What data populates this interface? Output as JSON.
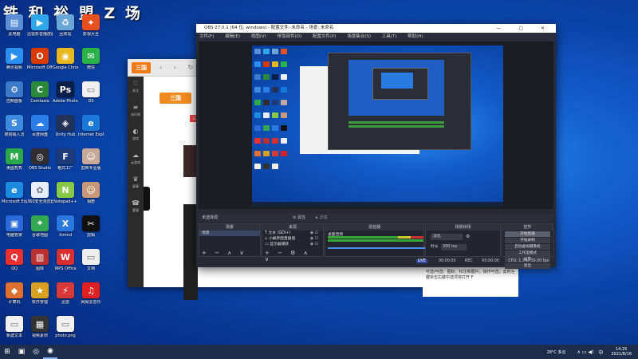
{
  "watermark": "铁 和 裕 盟 Z 场",
  "desktop_icons": [
    {
      "name": "此电脑",
      "color": "#5a8fd8",
      "glyph": "▤",
      "icon": "computer-icon"
    },
    {
      "name": "迅雷影音播放器",
      "color": "#2fa6ea",
      "glyph": "▶",
      "icon": "player-icon"
    },
    {
      "name": "回收站",
      "color": "#6aa6d8",
      "glyph": "♻",
      "icon": "recycle-bin-icon"
    },
    {
      "name": "影视大全",
      "color": "#e85020",
      "glyph": "✦",
      "icon": "video-icon"
    },
    {
      "name": "腾讯视频",
      "color": "#2a90f0",
      "glyph": "▶",
      "icon": "tencent-video-icon"
    },
    {
      "name": "Microsoft Office",
      "color": "#d83b01",
      "glyph": "O",
      "icon": "office-icon"
    },
    {
      "name": "Google Chrome",
      "color": "#e8b820",
      "glyph": "◉",
      "icon": "chrome-icon"
    },
    {
      "name": "微信",
      "color": "#2bb34a",
      "glyph": "✉",
      "icon": "wechat-icon"
    },
    {
      "name": "控制面板",
      "color": "#3a78c8",
      "glyph": "⚙",
      "icon": "control-panel-icon"
    },
    {
      "name": "Camtasia",
      "color": "#2a8a3a",
      "glyph": "C",
      "icon": "camtasia-icon"
    },
    {
      "name": "Adobe Photoshop",
      "color": "#0b1e4a",
      "glyph": "Ps",
      "icon": "photoshop-icon"
    },
    {
      "name": "DS",
      "color": "#f0f0f0",
      "glyph": "▭",
      "icon": "document-icon"
    },
    {
      "name": "搜狗输入法",
      "color": "#3d8be0",
      "glyph": "S",
      "icon": "sogou-icon"
    },
    {
      "name": "百度网盘",
      "color": "#2d7de8",
      "glyph": "☁",
      "icon": "baidu-netdisk-icon"
    },
    {
      "name": "Unity Hub",
      "color": "#223355",
      "glyph": "◈",
      "icon": "unity-icon"
    },
    {
      "name": "Internet Explorer",
      "color": "#1a78d8",
      "glyph": "e",
      "icon": "ie-icon"
    },
    {
      "name": "美图秀秀",
      "color": "#2aa84a",
      "glyph": "M",
      "icon": "meitu-icon"
    },
    {
      "name": "OBS Studio",
      "color": "#302e31",
      "glyph": "◎",
      "icon": "obs-icon"
    },
    {
      "name": "格式工厂",
      "color": "#1f3a7a",
      "glyph": "F",
      "icon": "format-factory-icon"
    },
    {
      "name": "剪映专业版",
      "color": "#c8a898",
      "glyph": "☺",
      "icon": "avatar-icon"
    },
    {
      "name": "Microsoft Edge",
      "color": "#1b8be0",
      "glyph": "e",
      "icon": "edge-icon"
    },
    {
      "name": "360安全浏览器",
      "color": "#e8f0ff",
      "glyph": "✿",
      "icon": "browser-icon"
    },
    {
      "name": "Notepad++",
      "color": "#8ac848",
      "glyph": "N",
      "icon": "notepad-icon"
    },
    {
      "name": "相册",
      "color": "#c89878",
      "glyph": "☺",
      "icon": "photo-icon"
    },
    {
      "name": "电脑管家",
      "color": "#2a6ad8",
      "glyph": "▣",
      "icon": "pc-manager-icon"
    },
    {
      "name": "谷歌地图",
      "color": "#34a853",
      "glyph": "⌖",
      "icon": "maps-icon"
    },
    {
      "name": "Xmind",
      "color": "#2a78e0",
      "glyph": "X",
      "icon": "xmind-icon"
    },
    {
      "name": "剪辑",
      "color": "#111111",
      "glyph": "✂",
      "icon": "clip-icon"
    },
    {
      "name": "QQ",
      "color": "#e83030",
      "glyph": "Q",
      "icon": "qq-icon"
    },
    {
      "name": "图库",
      "color": "#b83030",
      "glyph": "▥",
      "icon": "library-icon"
    },
    {
      "name": "WPS Office",
      "color": "#d83030",
      "glyph": "W",
      "icon": "wps-icon"
    },
    {
      "name": "文档",
      "color": "#eeeeee",
      "glyph": "▭",
      "icon": "file-icon"
    },
    {
      "name": "计算机",
      "color": "#e07030",
      "glyph": "◆",
      "icon": "app-icon"
    },
    {
      "name": "软件管理",
      "color": "#d8a020",
      "glyph": "★",
      "icon": "software-icon"
    },
    {
      "name": "迅雷",
      "color": "#d83a3a",
      "glyph": "⚡",
      "icon": "thunder-icon"
    },
    {
      "name": "网易云音乐",
      "color": "#e02020",
      "glyph": "♫",
      "icon": "music-icon"
    },
    {
      "name": "新建文本",
      "color": "#f0f0f0",
      "glyph": "▭",
      "icon": "text-file-icon"
    },
    {
      "name": "视频素材",
      "color": "#333333",
      "glyph": "▦",
      "icon": "film-icon"
    },
    {
      "name": "photo.png",
      "color": "#f0f0f0",
      "glyph": "▭",
      "icon": "image-file-icon"
    }
  ],
  "browser": {
    "logo": "三国",
    "nav_glyphs": "‹ › ↻ ⌂",
    "site_logo": "三国",
    "site_nav": "首页",
    "sidebar": [
      {
        "label": "关注",
        "glyph": "♡"
      },
      {
        "label": "排行榜",
        "glyph": "≡"
      },
      {
        "label": "游戏",
        "glyph": "◐"
      },
      {
        "label": "云游戏",
        "glyph": "☁"
      },
      {
        "label": "赛事",
        "glyph": "♛"
      },
      {
        "label": "客服",
        "glyph": "☎"
      }
    ],
    "tag": "三国",
    "footer_text": "可选/可选：图标、标注和图片。操作可选，此时左键单击右键中选项将打开 F"
  },
  "obs": {
    "title": "OBS 27.0.1 (64 位, windows) - 配置文件: 未命名 - 场景: 未命名",
    "window_controls": "— ▢ ✕",
    "menu": [
      "文件(F)",
      "编辑(E)",
      "视图(V)",
      "停靠部件(D)",
      "配置文件(P)",
      "场景集合(S)",
      "工具(T)",
      "帮助(H)"
    ],
    "no_source_label": "未选择源",
    "properties_label": "⚙ 属性",
    "filters_label": "◈ 滤镜",
    "docks": {
      "scenes": {
        "title": "场景",
        "items": [
          "场景"
        ]
      },
      "sources": {
        "title": "来源",
        "items": [
          "文本 (GDI+)",
          "小蜗界面直播窗",
          "显示器捕获"
        ]
      },
      "mixer": {
        "title": "混音器",
        "items": [
          "桌面音频"
        ]
      },
      "transitions": {
        "title": "场景转场",
        "selected": "淡化",
        "duration_label": "时长",
        "duration_value": "300 ms"
      },
      "controls": {
        "title": "控件",
        "buttons": [
          "开始直播",
          "开始录制",
          "启动虚拟摄像机",
          "工作室模式",
          "设置",
          "退出"
        ]
      }
    },
    "dock_footer": "+ − ∧ ∨",
    "source_footer": "+ − ⚙ ∧ ∨",
    "status": {
      "live_badge": "LIVE",
      "live_time": "00:00:00",
      "rec_label": "REC",
      "rec_time": "00:00:00",
      "cpu": "CPU: 1.3%, 30.00 fps"
    }
  },
  "taskbar": {
    "items": [
      "⊞",
      "▣",
      "◎",
      "◉"
    ],
    "weather": "28°C  多云",
    "tray_symbols": "∧ ▭ ◀)",
    "ime": "中",
    "time": "14:25",
    "date": "2021/8/16"
  }
}
